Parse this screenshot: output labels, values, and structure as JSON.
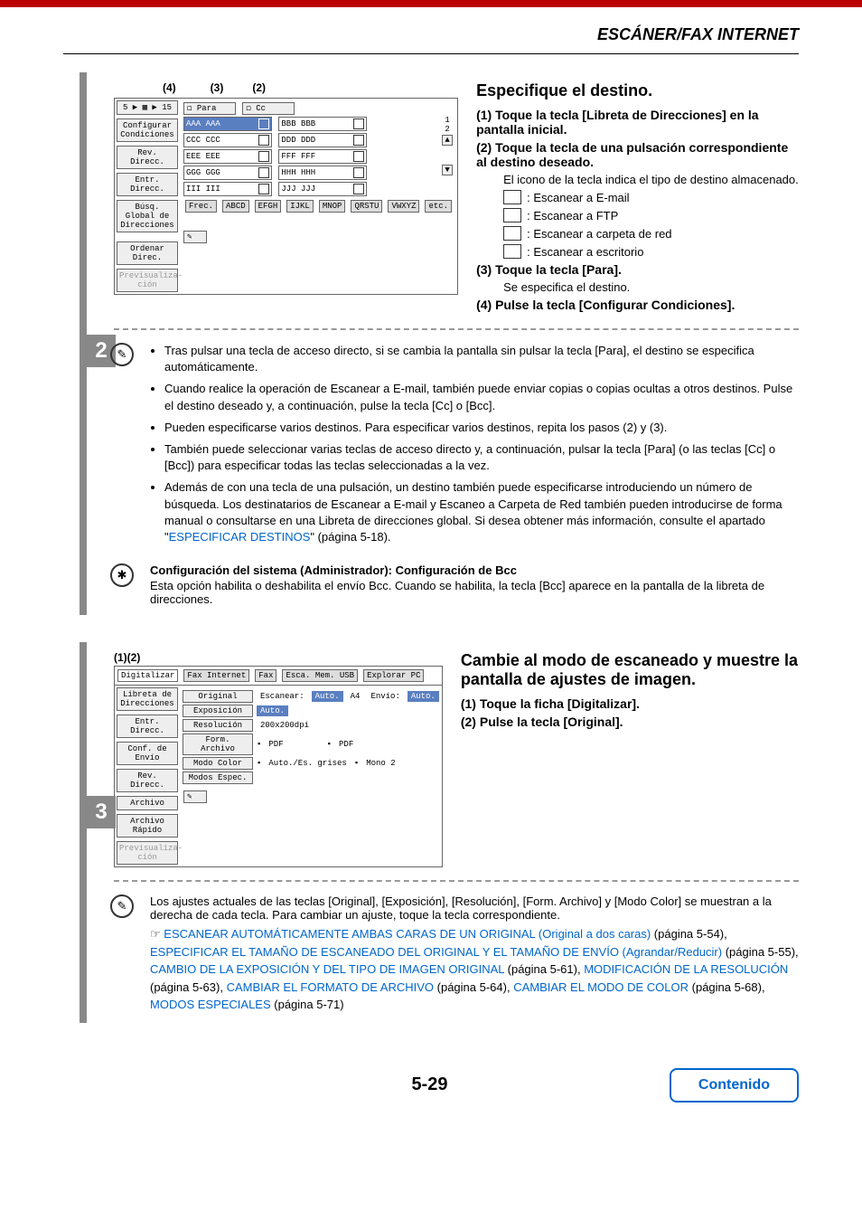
{
  "header": "ESCÁNER/FAX INTERNET",
  "step2": {
    "num": "2",
    "labels": {
      "l4": "(4)",
      "l3": "(3)",
      "l2": "(2)"
    },
    "ui": {
      "breadcrumb": "5 ▶ ▦ ▶ 15",
      "side": [
        "Configurar Condiciones",
        "Rev. Direcc.",
        "Entr. Direcc.",
        "Búsq. Global de Direcciones",
        "Ordenar Direc.",
        "Previsualiza-ción"
      ],
      "para": "Para",
      "cc": "Cc",
      "addrs": [
        {
          "n": "AAA AAA",
          "sel": true
        },
        {
          "n": "BBB BBB"
        },
        {
          "n": "CCC CCC"
        },
        {
          "n": "DDD DDD"
        },
        {
          "n": "EEE EEE"
        },
        {
          "n": "FFF FFF"
        },
        {
          "n": "GGG GGG"
        },
        {
          "n": "HHH HHH"
        },
        {
          "n": "III III"
        },
        {
          "n": "JJJ JJJ"
        }
      ],
      "nums": [
        "1",
        "2"
      ],
      "tabs": [
        "Frec.",
        "ABCD",
        "EFGH",
        "IJKL",
        "MNOP",
        "QRSTU",
        "VWXYZ",
        "etc."
      ]
    },
    "title": "Especifique el destino.",
    "s1": "(1) Toque la tecla [Libreta de Direcciones] en la pantalla inicial.",
    "s2": "(2) Toque la tecla de una pulsación correspondiente al destino deseado.",
    "s2desc": "El icono de la tecla indica el tipo de destino almacenado.",
    "icons": [
      ": Escanear a E-mail",
      ": Escanear a FTP",
      ": Escanear a carpeta de red",
      ": Escanear a escritorio"
    ],
    "s3": "(3) Toque la tecla [Para].",
    "s3desc": "Se especifica el destino.",
    "s4": "(4) Pulse la tecla [Configurar Condiciones].",
    "notes": [
      "Tras pulsar una tecla de acceso directo, si se cambia la pantalla sin pulsar la tecla [Para], el destino se especifica automáticamente.",
      "Cuando realice la operación de Escanear a E-mail, también puede enviar copias o copias ocultas a otros destinos. Pulse el destino deseado y, a continuación, pulse la tecla [Cc] o [Bcc].",
      "Pueden especificarse varios destinos. Para especificar varios destinos, repita los pasos (2) y (3).",
      "También puede seleccionar varias teclas de acceso directo y, a continuación, pulsar la tecla [Para] (o las teclas [Cc] o [Bcc]) para especificar todas las teclas seleccionadas a la vez."
    ],
    "note5a": "Además de con una tecla de una pulsación, un destino también puede especificarse introduciendo un número de búsqueda. Los destinatarios de Escanear a E-mail y Escaneo a Carpeta de Red también pueden introducirse de forma manual o consultarse en una Libreta de direcciones global. Si desea obtener más información, consulte el apartado \"",
    "note5link": "ESPECIFICAR DESTINOS",
    "note5b": "\" (página 5-18).",
    "admTitle": "Configuración del sistema (Administrador): Configuración de Bcc",
    "admBody": "Esta opción habilita o deshabilita el envío Bcc. Cuando se habilita, la tecla [Bcc] aparece en la pantalla de la libreta de direcciones."
  },
  "step3": {
    "num": "3",
    "labels": {
      "l1": "(1)",
      "l2": "(2)"
    },
    "ui": {
      "tabs": [
        "Digitalizar",
        "Fax Internet",
        "Fax",
        "Esca. Mem. USB",
        "Explorar PC"
      ],
      "side": [
        "Libreta de Direcciones",
        "Entr. Direcc.",
        "Conf. de Envío",
        "Rev. Direcc.",
        "Archivo",
        "Archivo Rápido",
        "Previsualiza-ción"
      ],
      "rows": [
        {
          "b": "Original",
          "t": "Escanear:",
          "v": "Auto.",
          "t2": "A4",
          "t3": "Envío:",
          "v2": "Auto."
        },
        {
          "b": "Exposición",
          "v": "Auto."
        },
        {
          "b": "Resolución",
          "t": "200x200dpi"
        },
        {
          "b": "Form. Archivo",
          "t": "PDF",
          "t2": "PDF"
        },
        {
          "b": "Modo Color",
          "t": "Auto./Es. grises",
          "t2": "Mono 2"
        },
        {
          "b": "Modos Espec."
        }
      ]
    },
    "title": "Cambie al modo de escaneado y muestre la pantalla de ajustes de imagen.",
    "s1": "(1) Toque la ficha [Digitalizar].",
    "s2": "(2) Pulse la tecla [Original].",
    "intro": "Los ajustes actuales de las teclas [Original], [Exposición], [Resolución], [Form. Archivo] y [Modo Color] se muestran a la derecha de cada tecla. Para cambiar un ajuste, toque la tecla correspondiente.",
    "hand": "☞",
    "links": [
      {
        "t": "ESCANEAR AUTOMÁTICAMENTE AMBAS CARAS DE UN ORIGINAL (Original a dos caras)",
        "p": " (página 5-54), "
      },
      {
        "t": "ESPECIFICAR EL TAMAÑO DE ESCANEADO DEL ORIGINAL Y EL TAMAÑO DE ENVÍO (Agrandar/Reducir)",
        "p": " (página 5-55), "
      },
      {
        "t": "CAMBIO DE LA EXPOSICIÓN Y DEL TIPO DE IMAGEN ORIGINAL",
        "p": " (página 5-61), "
      },
      {
        "t": "MODIFICACIÓN DE LA RESOLUCIÓN",
        "p": " (página 5-63), "
      },
      {
        "t": "CAMBIAR EL FORMATO DE ARCHIVO",
        "p": " (página 5-64), "
      },
      {
        "t": "CAMBIAR EL MODO DE COLOR",
        "p": " (página 5-68), "
      },
      {
        "t": "MODOS ESPECIALES",
        "p": " (página 5-71)"
      }
    ]
  },
  "footer": {
    "page": "5-29",
    "contents": "Contenido"
  }
}
